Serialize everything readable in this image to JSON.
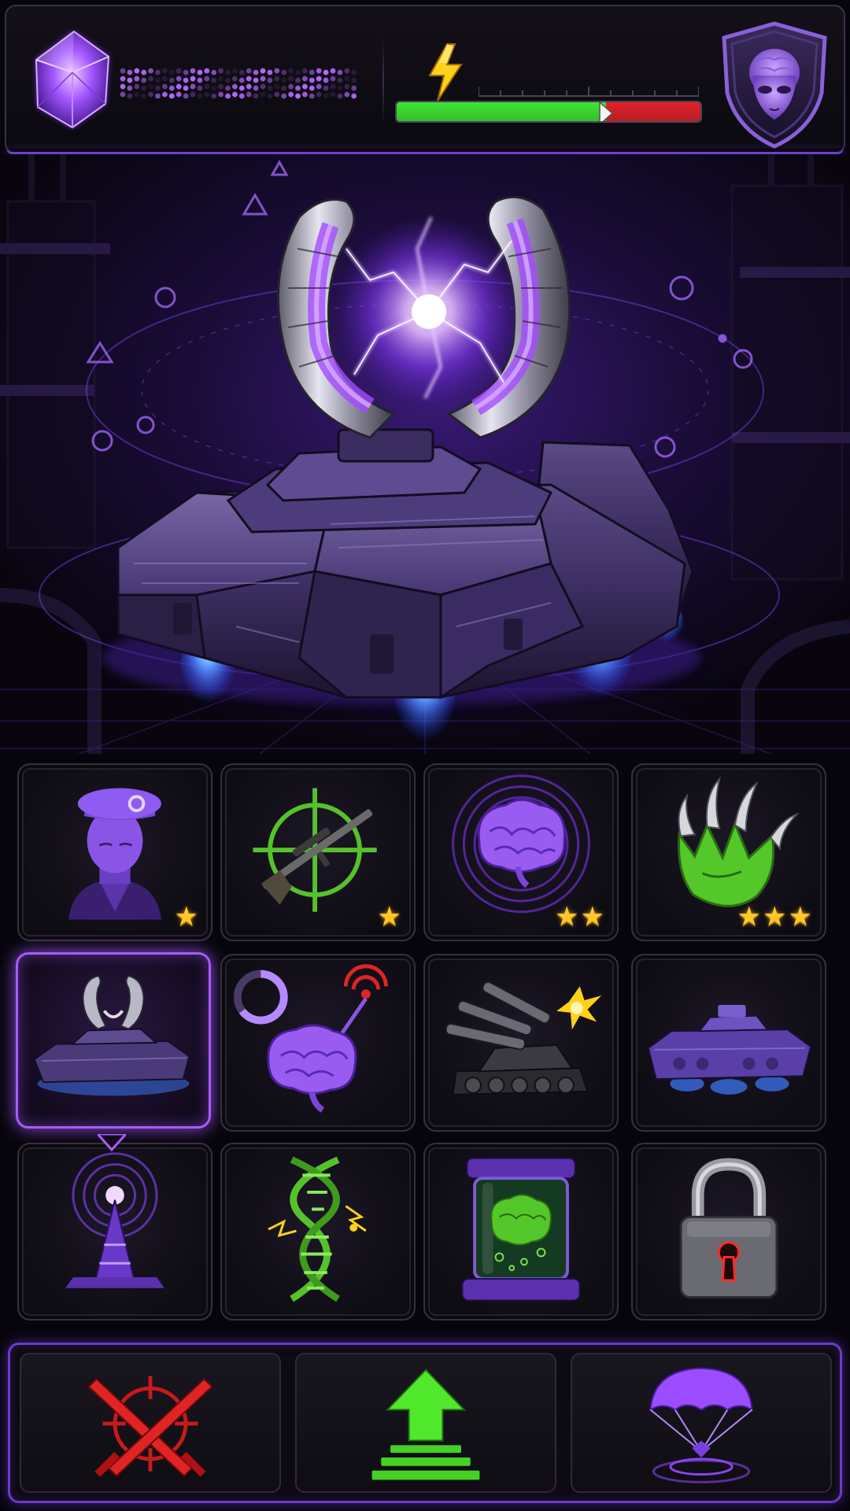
{
  "header": {
    "resource": {
      "icon": "purple-crystal-icon",
      "meter_fill": 1.0,
      "color": "#b469ff"
    },
    "energy": {
      "icon": "lightning-bolt-icon",
      "green_fraction": 0.69,
      "red_fraction": 0.31,
      "green_color": "#3ee632",
      "red_color": "#e0202a"
    },
    "faction_emblem": {
      "icon": "alien-head-shield-icon"
    }
  },
  "hero": {
    "unit": "psionic-hover-tank",
    "accent": "#9b4dff",
    "thruster_color": "#4f8dff"
  },
  "upgrades": [
    {
      "name": "commander",
      "icon": "soldier-beret-icon",
      "stars": 1,
      "selected": false,
      "locked": false
    },
    {
      "name": "sniper",
      "icon": "crosshair-rifle-icon",
      "stars": 1,
      "selected": false,
      "locked": false
    },
    {
      "name": "psionic-brain",
      "icon": "brain-waves-icon",
      "stars": 2,
      "selected": false,
      "locked": false
    },
    {
      "name": "mutant-claw",
      "icon": "green-claw-icon",
      "stars": 3,
      "selected": false,
      "locked": false
    },
    {
      "name": "psionic-tank",
      "icon": "psi-tank-icon",
      "stars": 0,
      "selected": true,
      "locked": false
    },
    {
      "name": "mind-signal",
      "icon": "brain-signal-icon",
      "stars": 0,
      "selected": false,
      "locked": false
    },
    {
      "name": "artillery",
      "icon": "multi-barrel-tank-icon",
      "stars": 0,
      "selected": false,
      "locked": false
    },
    {
      "name": "hover-tank",
      "icon": "hover-tank-icon",
      "stars": 0,
      "selected": false,
      "locked": false
    },
    {
      "name": "psi-tower",
      "icon": "psi-tower-icon",
      "stars": 0,
      "selected": false,
      "locked": false
    },
    {
      "name": "gene-mutation",
      "icon": "dna-helix-icon",
      "stars": 0,
      "selected": false,
      "locked": false
    },
    {
      "name": "brain-vat",
      "icon": "brain-jar-icon",
      "stars": 0,
      "selected": false,
      "locked": false
    },
    {
      "name": "locked-slot",
      "icon": "padlock-icon",
      "stars": 0,
      "selected": false,
      "locked": true
    }
  ],
  "actions": [
    {
      "name": "attack",
      "icon": "crossed-swords-target-icon",
      "color": "#e02424"
    },
    {
      "name": "upgrade",
      "icon": "up-arrow-icon",
      "color": "#4fe82a"
    },
    {
      "name": "airdrop",
      "icon": "parachute-icon",
      "color": "#9b4dff"
    }
  ],
  "colors": {
    "accent": "#9b4dff",
    "gold": "#ffc82a",
    "green": "#4fe82a",
    "red": "#e02424"
  }
}
